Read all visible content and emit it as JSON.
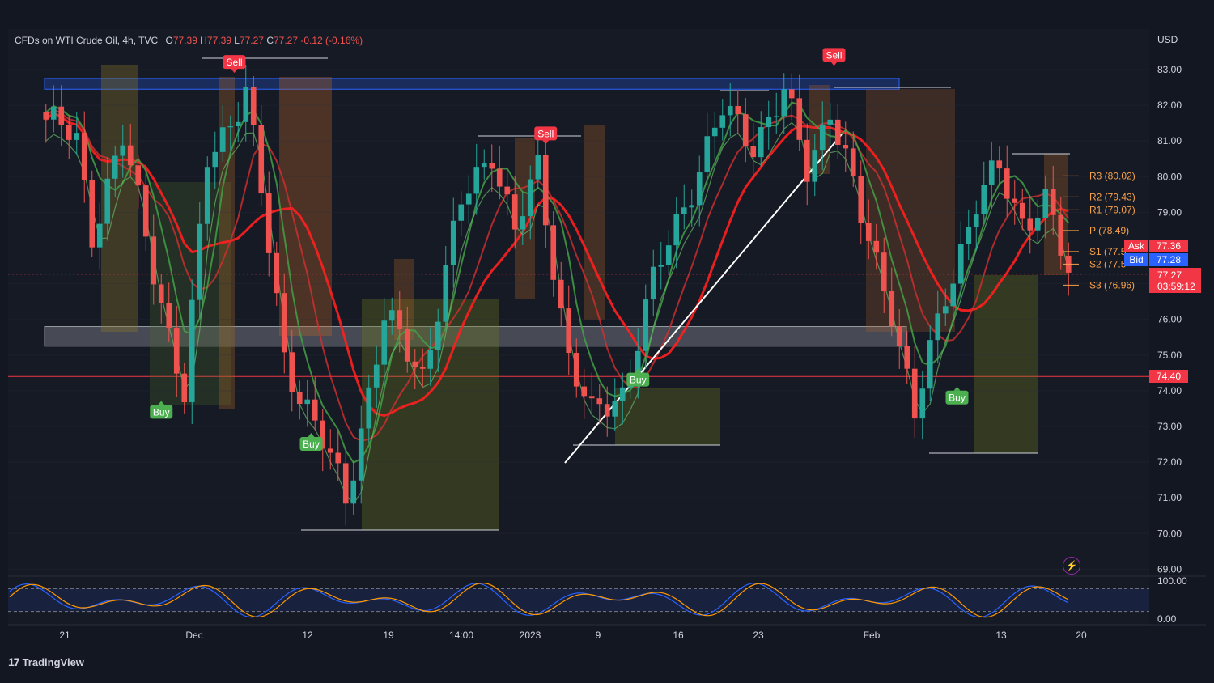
{
  "header": {
    "symbol": "CFDs on WTI Crude Oil, 4h, TVC",
    "open_label": "O",
    "open": "77.39",
    "high_label": "H",
    "high": "77.39",
    "low_label": "L",
    "low": "77.27",
    "close_label": "C",
    "close": "77.27",
    "change": "-0.12 (-0.16%)"
  },
  "currency": "USD",
  "footer": {
    "brand": "TradingView"
  },
  "colors": {
    "background": "#131722",
    "up": "#26a69a",
    "down": "#ef5350",
    "sell_tag": "#f23645",
    "buy_tag": "#4caf50",
    "pivot": "#f7a14a",
    "zone_blue": "#2962ff",
    "ask": "#f23645",
    "bid": "#2962ff"
  },
  "chart_data": {
    "type": "candlestick",
    "ylim": [
      69,
      83.5
    ],
    "y_ticks": [
      "83.00",
      "82.00",
      "81.00",
      "80.00",
      "79.00",
      "78.00",
      "77.00",
      "76.00",
      "75.00",
      "74.00",
      "73.00",
      "72.00",
      "71.00",
      "70.00",
      "69.00"
    ],
    "x_ticks": [
      "21",
      "Dec",
      "12",
      "19",
      "14:00",
      "2023",
      "9",
      "16",
      "23",
      "Feb",
      "13",
      "20"
    ],
    "price_anchors": [
      {
        "x": 0,
        "p": 81.6
      },
      {
        "x": 4,
        "p": 81.0
      },
      {
        "x": 6,
        "p": 78.5
      },
      {
        "x": 10,
        "p": 81.0
      },
      {
        "x": 14,
        "p": 77.5
      },
      {
        "x": 18,
        "p": 73.8
      },
      {
        "x": 21,
        "p": 80.5
      },
      {
        "x": 26,
        "p": 82.4
      },
      {
        "x": 31,
        "p": 75.0
      },
      {
        "x": 36,
        "p": 72.5
      },
      {
        "x": 39,
        "p": 71.0
      },
      {
        "x": 44,
        "p": 76.0
      },
      {
        "x": 49,
        "p": 74.5
      },
      {
        "x": 54,
        "p": 79.2
      },
      {
        "x": 58,
        "p": 80.8
      },
      {
        "x": 61,
        "p": 78.4
      },
      {
        "x": 64,
        "p": 80.2
      },
      {
        "x": 68,
        "p": 75.0
      },
      {
        "x": 71,
        "p": 73.2
      },
      {
        "x": 75,
        "p": 74.0
      },
      {
        "x": 79,
        "p": 77.0
      },
      {
        "x": 84,
        "p": 79.8
      },
      {
        "x": 88,
        "p": 81.8
      },
      {
        "x": 92,
        "p": 81.0
      },
      {
        "x": 96,
        "p": 82.3
      },
      {
        "x": 99,
        "p": 80.2
      },
      {
        "x": 102,
        "p": 82.0
      },
      {
        "x": 106,
        "p": 78.8
      },
      {
        "x": 110,
        "p": 76.4
      },
      {
        "x": 113,
        "p": 73.2
      },
      {
        "x": 117,
        "p": 76.8
      },
      {
        "x": 121,
        "p": 79.2
      },
      {
        "x": 124,
        "p": 80.2
      },
      {
        "x": 127,
        "p": 78.8
      },
      {
        "x": 130,
        "p": 79.2
      },
      {
        "x": 133,
        "p": 77.27
      }
    ],
    "resistance_zone": [
      82.45,
      82.75
    ],
    "support_zone": [
      75.25,
      75.8
    ],
    "horizontal_line": 74.4,
    "pivots": [
      {
        "label": "R3 (80.02)",
        "value": 80.02
      },
      {
        "label": "R2 (79.43)",
        "value": 79.43
      },
      {
        "label": "R1 (79.07)",
        "value": 79.07
      },
      {
        "label": "P (78.49)",
        "value": 78.49
      },
      {
        "label": "S1 (77.5",
        "value": 77.9
      },
      {
        "label": "S2 (77.5",
        "value": 77.55
      },
      {
        "label": "S3 (76.96)",
        "value": 76.96
      }
    ],
    "price_tags": {
      "ask_label": "Ask",
      "ask": "77.36",
      "bid_label": "Bid",
      "bid": "77.28",
      "last": "77.27",
      "countdown": "03:59:12",
      "level": "74.40"
    },
    "signals": [
      {
        "type": "Sell",
        "text": "Sell",
        "bar": 24.5,
        "price": 83.2
      },
      {
        "type": "Sell",
        "text": "Sell",
        "bar": 65,
        "price": 81.2
      },
      {
        "type": "Sell",
        "text": "Sell",
        "bar": 102.5,
        "price": 83.4
      },
      {
        "type": "Buy",
        "text": "Buy",
        "bar": 15,
        "price": 73.4
      },
      {
        "type": "Buy",
        "text": "Buy",
        "bar": 34.5,
        "price": 72.5
      },
      {
        "type": "Buy",
        "text": "Buy",
        "bar": 77,
        "price": 74.3
      },
      {
        "type": "Buy",
        "text": "Buy",
        "bar": 118.5,
        "price": 73.8
      }
    ],
    "oscillator": {
      "ylim": [
        0,
        100
      ],
      "y_ticks": [
        "100.00",
        "0.00"
      ],
      "bands": [
        80,
        20
      ]
    }
  }
}
